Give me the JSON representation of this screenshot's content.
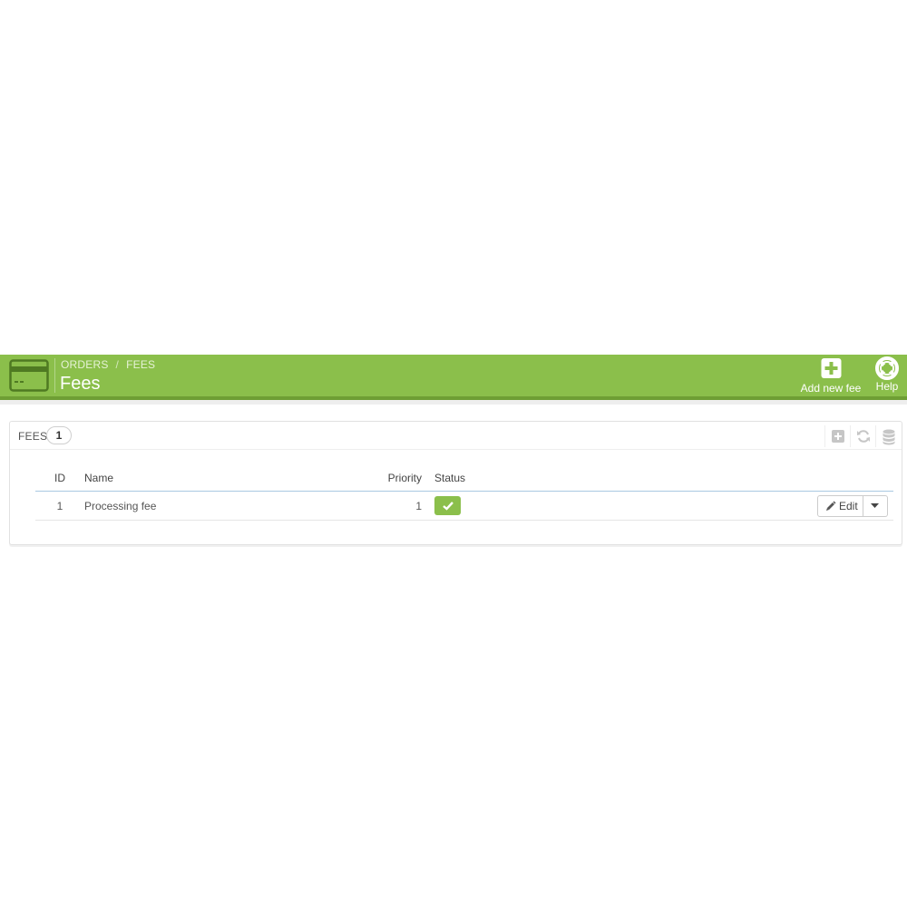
{
  "header": {
    "breadcrumb": [
      "ORDERS",
      "FEES"
    ],
    "breadcrumb_separator": "/",
    "title": "Fees",
    "actions": [
      {
        "label": "Add new fee",
        "icon": "plus-square-icon"
      },
      {
        "label": "Help",
        "icon": "lifebuoy-icon"
      }
    ],
    "accent_color": "#8bbf4b"
  },
  "panel": {
    "title": "FEES",
    "count": "1",
    "tools": [
      "add-icon",
      "refresh-icon",
      "database-icon"
    ]
  },
  "table": {
    "columns": {
      "id": "ID",
      "name": "Name",
      "priority": "Priority",
      "status": "Status"
    },
    "rows": [
      {
        "id": "1",
        "name": "Processing fee",
        "priority": "1",
        "status": "enabled",
        "edit_label": "Edit"
      }
    ]
  }
}
